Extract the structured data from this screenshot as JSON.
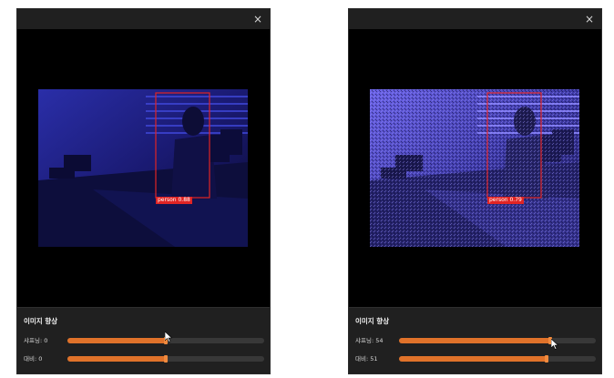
{
  "windows": [
    {
      "id": "left",
      "close_icon": "×",
      "detection_label": "person 0.88",
      "panel_title": "이미지 향상",
      "sharpness": {
        "label": "샤프닝: 0",
        "fraction": 0.5
      },
      "contrast": {
        "label": "대비: 0",
        "fraction": 0.5
      }
    },
    {
      "id": "right",
      "close_icon": "×",
      "detection_label": "person 0.79",
      "panel_title": "이미지 향상",
      "sharpness": {
        "label": "샤프닝: 54",
        "fraction": 0.77
      },
      "contrast": {
        "label": "대비: 51",
        "fraction": 0.75
      }
    }
  ],
  "icons": {
    "close": "close-icon",
    "cursor": "mouse-pointer-icon"
  },
  "colors": {
    "accent": "#e0722a",
    "detection_box": "#e02424",
    "panel": "#202020"
  }
}
